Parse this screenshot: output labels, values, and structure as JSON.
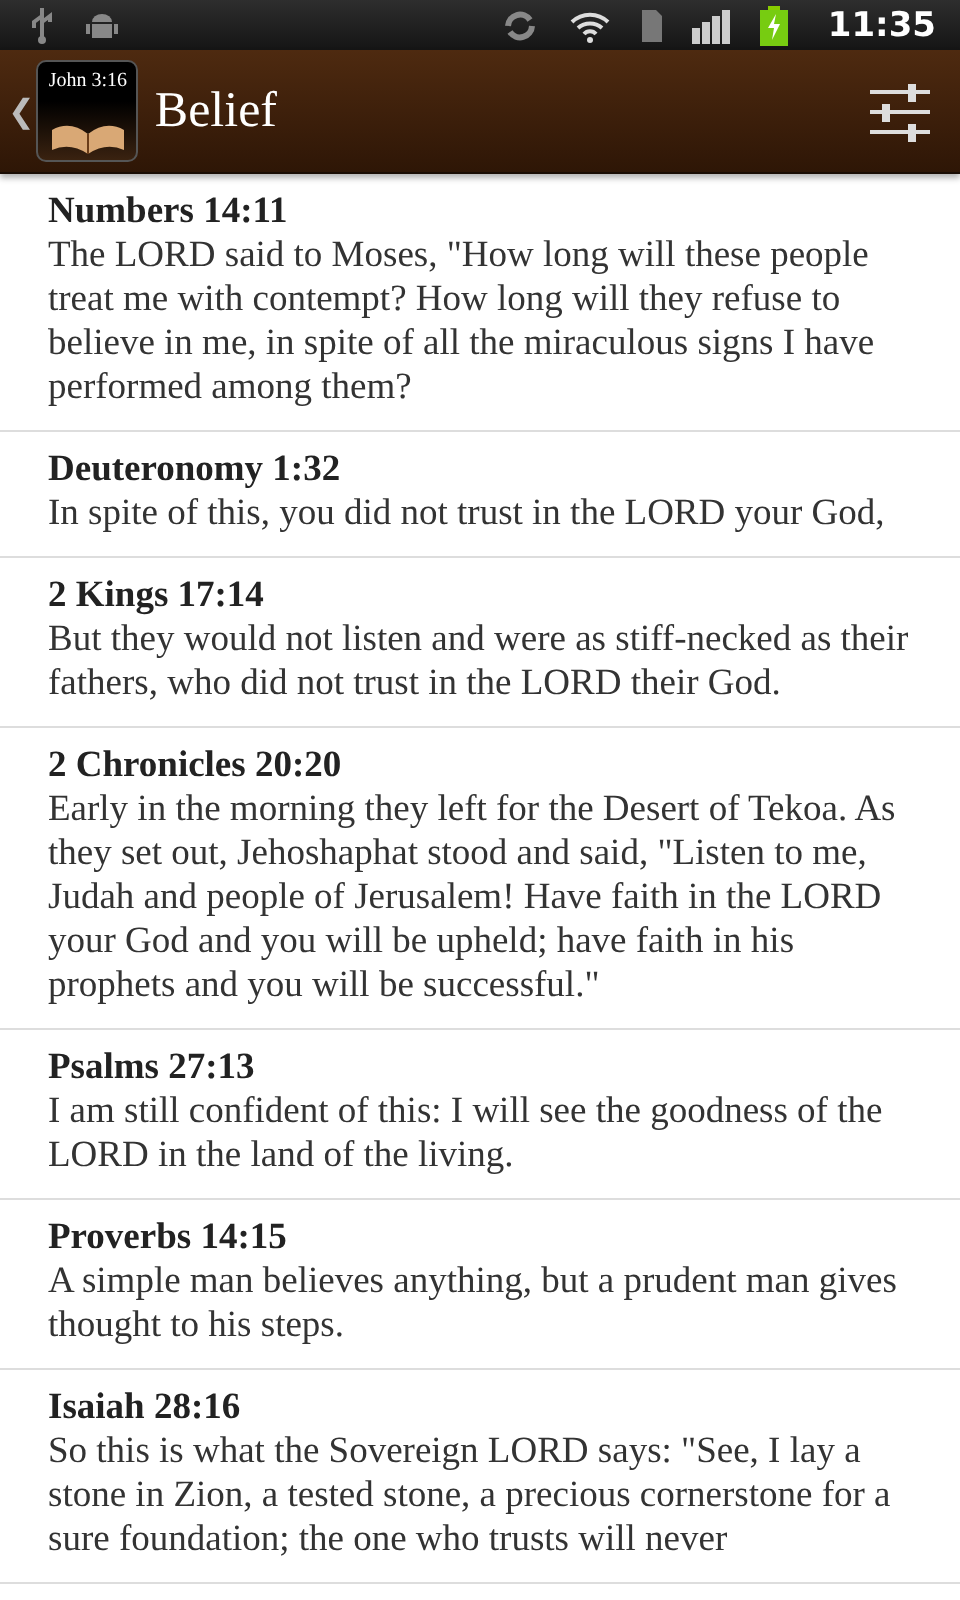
{
  "status_bar": {
    "time": "11:35"
  },
  "header": {
    "back": "❮",
    "badge": "John 3:16",
    "title": "Belief"
  },
  "verses": [
    {
      "reference": "Numbers 14:11",
      "text": "The LORD said to Moses, \"How long will these people treat me with contempt? How long will they refuse to believe in me, in spite of all the miraculous signs I have performed among them?"
    },
    {
      "reference": "Deuteronomy 1:32",
      "text": "In spite of this, you did not trust in the LORD your God,"
    },
    {
      "reference": "2 Kings 17:14",
      "text": "But they would not listen and were as stiff-necked as their fathers, who did not trust in the LORD their God."
    },
    {
      "reference": "2 Chronicles 20:20",
      "text": "Early in the morning they left for the Desert of Tekoa. As they set out, Jehoshaphat stood and said, \"Listen to me, Judah and people of Jerusalem! Have faith in the LORD your God and you will be upheld; have faith in his prophets and you will be successful.\""
    },
    {
      "reference": "Psalms 27:13",
      "text": "I am still confident of this: I will see the goodness of the LORD in the land of the living."
    },
    {
      "reference": "Proverbs 14:15",
      "text": "A simple man believes anything, but a prudent man gives thought to his steps."
    },
    {
      "reference": "Isaiah 28:16",
      "text": "So this is what the Sovereign LORD says: \"See, I lay a stone in Zion, a tested stone, a precious cornerstone for a sure foundation; the one who trusts will never"
    }
  ]
}
